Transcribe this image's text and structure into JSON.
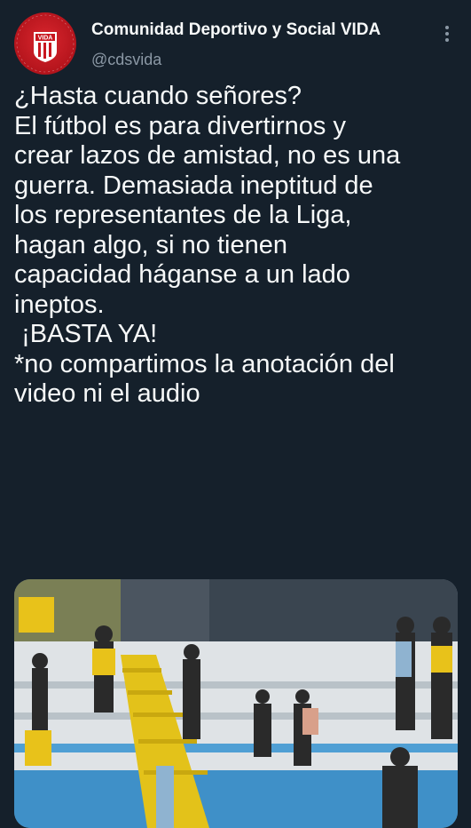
{
  "account": {
    "display_name": "Comunidad Deportivo y Social VIDA",
    "handle": "@cdsvida",
    "avatar_text": "VIDA"
  },
  "tweet": {
    "lines": [
      "¿Hasta cuando señores?",
      "",
      "El fútbol es para divertirnos y",
      "crear lazos de amistad, no es una",
      "guerra. Demasiada ineptitud de",
      "los representantes de la Liga,",
      "hagan algo, si no tienen",
      "capacidad háganse a un lado",
      "ineptos.",
      " ¡BASTA YA!",
      "",
      "*no compartimos la anotación del",
      "video ni el audio"
    ]
  },
  "icons": {
    "more": "more-options-icon"
  },
  "colors": {
    "background": "#15202b",
    "text_primary": "#f7f9f9",
    "text_secondary": "#8b98a5",
    "avatar_red": "#c8161f"
  }
}
